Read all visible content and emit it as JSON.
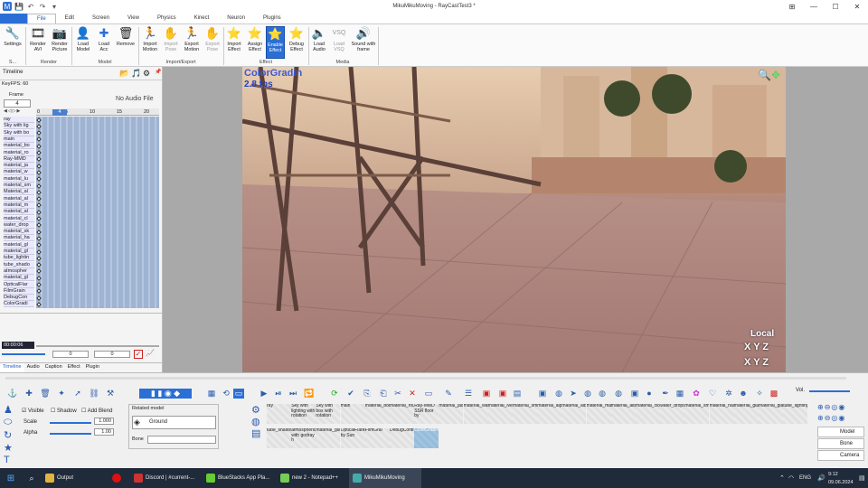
{
  "window": {
    "title": "MikuMikuMoving - RayCastTest3 *"
  },
  "menu_tabs": [
    "File",
    "Edit",
    "Screen",
    "View",
    "Physics",
    "Kinect",
    "Neuron",
    "Plugins"
  ],
  "ribbon": {
    "buttons": [
      {
        "label": "Settings",
        "icon": "wrench-icon"
      },
      {
        "label": "Render AVI",
        "icon": "film-icon"
      },
      {
        "label": "Render Picture",
        "icon": "camera-icon"
      },
      {
        "label": "Load Model",
        "icon": "person-icon"
      },
      {
        "label": "Load Acc",
        "icon": "plus-icon"
      },
      {
        "label": "Remove",
        "icon": "trash-icon"
      },
      {
        "label": "Import Motion",
        "icon": "run-icon"
      },
      {
        "label": "Import Pose",
        "icon": "hand-icon"
      },
      {
        "label": "Export Motion",
        "icon": "run-icon"
      },
      {
        "label": "Export Pose",
        "icon": "hand-icon"
      },
      {
        "label": "Import Effect",
        "icon": "star-icon"
      },
      {
        "label": "Assign Effect",
        "icon": "star-icon"
      },
      {
        "label": "Enable Effect",
        "icon": "star-icon"
      },
      {
        "label": "Debug Effect",
        "icon": "star-icon"
      },
      {
        "label": "Load Audio",
        "icon": "speaker-icon"
      },
      {
        "label": "Load VSQ",
        "icon": "vsq-icon"
      },
      {
        "label": "Sound with frame",
        "icon": "sound-icon"
      }
    ],
    "groups": [
      "S...",
      "Render",
      "Model",
      "Import/Export",
      "Effect",
      "Media"
    ]
  },
  "timeline": {
    "title": "Timeline",
    "key_fps": "KeyFPS: 60",
    "frame_label": "Frame",
    "frame_value": "4",
    "no_audio": "No Audio File",
    "ruler": [
      "0",
      "5",
      "10",
      "15",
      "20"
    ],
    "current_marker": "4",
    "tracks": [
      "ray",
      "Sky with lig",
      "Sky with bo",
      "main",
      "material_bo",
      "material_ro",
      "Ray-MMD",
      "material_ja",
      "material_w",
      "material_lu",
      "material_sm",
      "Material_al",
      "material_al",
      "material_m",
      "material_al",
      "material_cl",
      "water_drop",
      "material_sk",
      "material_ha",
      "material_gl",
      "material_gl",
      "tube_lightin",
      "tube_shado",
      "atmospher",
      "material_gl",
      "OpticalFlar",
      "FilmGrain",
      "DebugCon",
      "ColorGradi"
    ],
    "time": "00:00:06",
    "spin1": "0",
    "spin2": "0",
    "bottom_tabs": [
      "Timeline",
      "Audio",
      "Caption",
      "Effect",
      "Plugin"
    ]
  },
  "viewport": {
    "effect_name": "ColorGradin",
    "fps": "2.8 fps",
    "mode": "Local",
    "axis1": "X Y Z",
    "axis2": "X Y Z"
  },
  "props": {
    "visible": "Visible",
    "shadow": "Shadow",
    "add_blend": "Add Blend",
    "scale_label": "Scale",
    "scale_value": "1.000",
    "alpha_label": "Alpha",
    "alpha_value": "1.00",
    "related_model": "Related model",
    "related_value": "Ground",
    "bone_label": "Bone",
    "vol": "Vol."
  },
  "models_row1": [
    "ray",
    "Sky with lighting with rotation",
    "Sky with box with rotation",
    "main",
    "material_body",
    "material_rough_iron",
    "Ray-MMD SSR floor by",
    "material_jade_white",
    "material_water",
    "material_lvetness2",
    "material_smooth_metal",
    "material_alpha_2.0",
    "material_albedo_x4",
    "material_marble",
    "material_albedo",
    "material_cloth",
    "water_drops_skin",
    "material_smooth_gold",
    "material_hair_with_anisotropy",
    "material_glass",
    "material_glass_refractive",
    "tube_lighting_very_hight"
  ],
  "models_row2": [
    "tube_shadow",
    "atmospheric_fog with godray h",
    "material_glass_refractive_frosted",
    "OpticalFlares by Sun",
    "FilmGrai",
    "DebugController",
    "ColorGrading"
  ],
  "side_buttons": [
    "Model",
    "Bone",
    "Camera"
  ],
  "taskbar": {
    "items": [
      "Output",
      "",
      "Discord | #current-...",
      "BlueStacks App Pla...",
      "new 2 - Notepad++",
      "MikuMikuMoving"
    ],
    "lang": "ENG",
    "time": "9:12",
    "date": "09.06.2024"
  }
}
